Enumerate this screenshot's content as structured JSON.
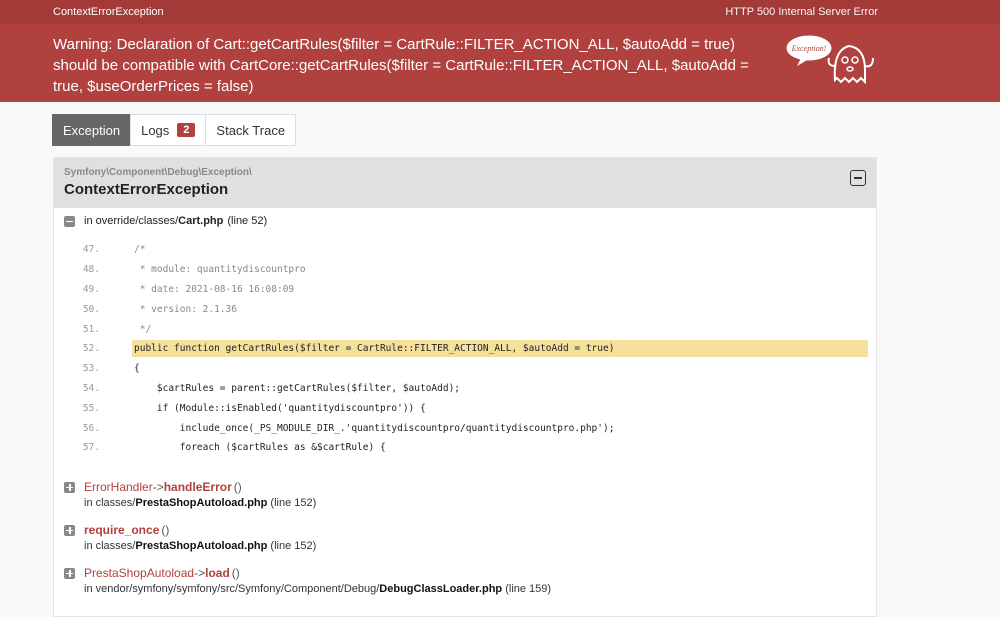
{
  "header": {
    "exception_name": "ContextErrorException",
    "status": "HTTP 500 Internal Server Error",
    "message": "Warning: Declaration of Cart::getCartRules($filter = CartRule::FILTER_ACTION_ALL, $autoAdd = true) should be compatible with CartCore::getCartRules($filter = CartRule::FILTER_ACTION_ALL, $autoAdd = true, $useOrderPrices = false)",
    "ghost_text": "Exception!"
  },
  "tabs": [
    {
      "label": "Exception",
      "active": true
    },
    {
      "label": "Logs",
      "badge": "2"
    },
    {
      "label": "Stack Trace"
    }
  ],
  "exception": {
    "namespace": "Symfony\\Component\\Debug\\Exception\\",
    "class": "ContextErrorException",
    "location_prefix": "in override/classes/",
    "location_file": "Cart.php",
    "location_line": "(line 52)"
  },
  "code_lines": [
    {
      "num": "47.",
      "text": "/*"
    },
    {
      "num": "48.",
      "text": " * module: quantitydiscountpro"
    },
    {
      "num": "49.",
      "text": " * date: 2021-08-16 16:08:09"
    },
    {
      "num": "50.",
      "text": " * version: 2.1.36"
    },
    {
      "num": "51.",
      "text": " */"
    },
    {
      "num": "52.",
      "text": "public function getCartRules($filter = CartRule::FILTER_ACTION_ALL, $autoAdd = true)"
    },
    {
      "num": "53.",
      "text": "{"
    },
    {
      "num": "54.",
      "text": "    $cartRules = parent::getCartRules($filter, $autoAdd);"
    },
    {
      "num": "55.",
      "text": "    if (Module::isEnabled('quantitydiscountpro')) {"
    },
    {
      "num": "56.",
      "text": "        include_once(_PS_MODULE_DIR_.'quantitydiscountpro/quantitydiscountpro.php');"
    },
    {
      "num": "57.",
      "text": "        foreach ($cartRules as &$cartRule) {"
    }
  ],
  "trace": [
    {
      "class": "ErrorHandler",
      "arrow": "->",
      "function": "handleError",
      "parens": "()",
      "file_prefix": "in classes/",
      "file": "PrestaShopAutoload.php",
      "line": "(line 152)"
    },
    {
      "class": "",
      "arrow": "",
      "function": "require_once",
      "parens": "()",
      "file_prefix": "in classes/",
      "file": "PrestaShopAutoload.php",
      "line": "(line 152)"
    },
    {
      "class": "PrestaShopAutoload",
      "arrow": "->",
      "function": "load",
      "parens": "()",
      "file_prefix": "in vendor/symfony/symfony/src/Symfony/Component/Debug/",
      "file": "DebugClassLoader.php",
      "line": "(line 159)"
    }
  ]
}
